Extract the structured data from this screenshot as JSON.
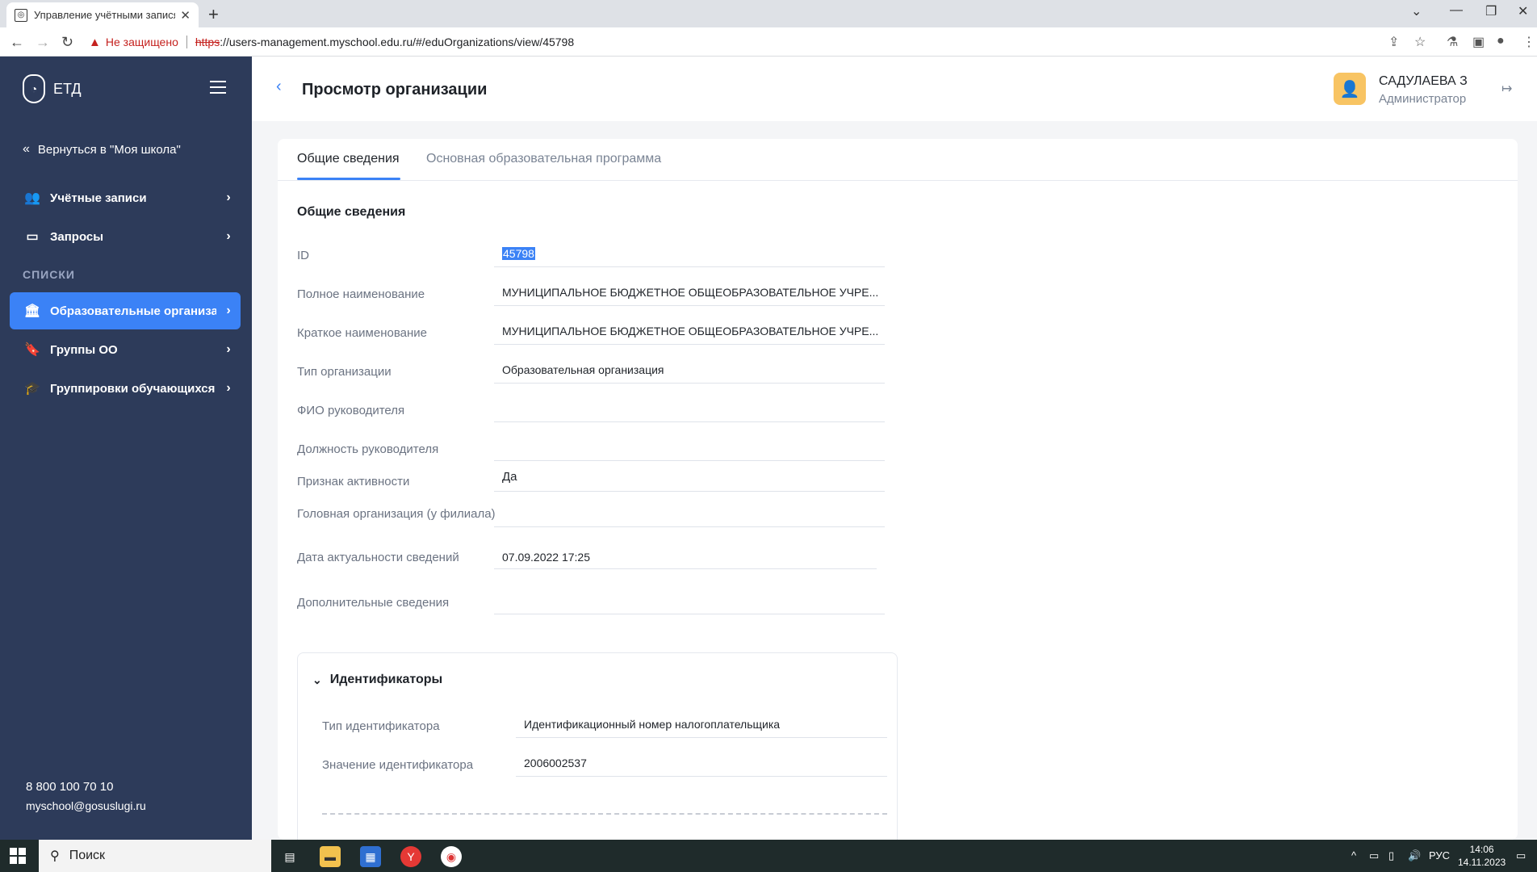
{
  "browser": {
    "tab_title": "Управление учётными записям",
    "not_secure": "Не защищено",
    "url_scheme": "https",
    "url_rest": "://users-management.myschool.edu.ru/#/eduOrganizations/view/45798"
  },
  "sidebar": {
    "logo_text": "ЕТД",
    "back_label": "Вернуться в \"Моя школа\"",
    "items": [
      {
        "label": "Учётные записи",
        "icon": "users-icon"
      },
      {
        "label": "Запросы",
        "icon": "inbox-icon"
      }
    ],
    "section_label": "СПИСКИ",
    "list_items": [
      {
        "label": "Образовательные организа...",
        "icon": "institution-icon"
      },
      {
        "label": "Группы ОО",
        "icon": "bookmark-icon"
      },
      {
        "label": "Группировки обучающихся",
        "icon": "graduation-icon"
      }
    ],
    "phone": "8 800 100 70 10",
    "email": "myschool@gosuslugi.ru"
  },
  "header": {
    "title": "Просмотр организации",
    "user_name": "САДУЛАЕВА З",
    "user_role": "Администратор"
  },
  "tabs": [
    {
      "label": "Общие сведения",
      "active": true
    },
    {
      "label": "Основная образовательная программа",
      "active": false
    }
  ],
  "general": {
    "section_title": "Общие сведения",
    "fields": [
      {
        "label": "ID",
        "value": "45798"
      },
      {
        "label": "Полное наименование",
        "value": "МУНИЦИПАЛЬНОЕ БЮДЖЕТНОЕ ОБЩЕОБРАЗОВАТЕЛЬНОЕ УЧРЕ..."
      },
      {
        "label": "Краткое наименование",
        "value": "МУНИЦИПАЛЬНОЕ БЮДЖЕТНОЕ ОБЩЕОБРАЗОВАТЕЛЬНОЕ УЧРЕ..."
      },
      {
        "label": "Тип организации",
        "value": "Образовательная организация"
      },
      {
        "label": "ФИО руководителя",
        "value": ""
      },
      {
        "label": "Должность руководителя",
        "value": ""
      },
      {
        "label": "Признак активности",
        "value": "Да"
      },
      {
        "label": "Головная организация (у филиала)",
        "value": ""
      },
      {
        "label": "Дата актуальности сведений",
        "value": "07.09.2022 17:25"
      },
      {
        "label": "Дополнительные сведения",
        "value": ""
      }
    ]
  },
  "identifiers": {
    "title": "Идентификаторы",
    "fields": [
      {
        "label": "Тип идентификатора",
        "value": "Идентификационный номер налогоплательщика"
      },
      {
        "label": "Значение идентификатора",
        "value": "2006002537"
      }
    ]
  },
  "taskbar": {
    "search_label": "Поиск",
    "lang": "РУС",
    "time": "14:06",
    "date": "14.11.2023"
  }
}
